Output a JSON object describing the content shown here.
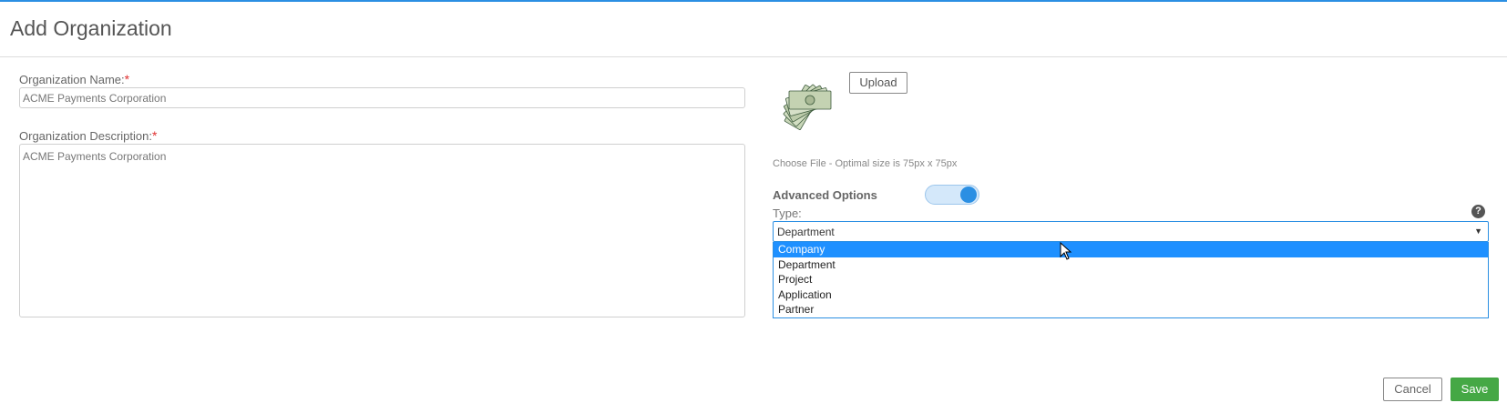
{
  "header": {
    "title": "Add Organization"
  },
  "form": {
    "name_label": "Organization Name:",
    "name_value": "ACME Payments Corporation",
    "description_label": "Organization Description:",
    "description_value": "ACME Payments Corporation",
    "required_mark": "*"
  },
  "logo": {
    "icon": "money-stack-icon",
    "upload_label": "Upload",
    "hint": "Choose File - Optimal size is 75px x 75px"
  },
  "advanced": {
    "label": "Advanced Options",
    "enabled": true,
    "type_label": "Type:",
    "help_glyph": "?",
    "selected": "Department",
    "options": [
      "Company",
      "Department",
      "Project",
      "Application",
      "Partner"
    ],
    "highlighted": "Company"
  },
  "actions": {
    "cancel_label": "Cancel",
    "save_label": "Save"
  },
  "colors": {
    "accent": "#2b8fe3",
    "save": "#45a845",
    "required": "#e03030",
    "highlight": "#1e90ff"
  }
}
